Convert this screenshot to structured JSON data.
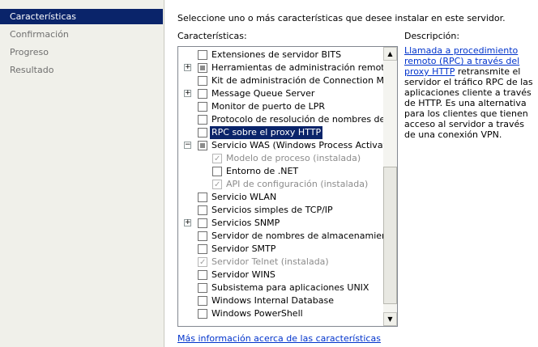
{
  "sidebar": {
    "items": [
      {
        "label": "Características",
        "active": true
      },
      {
        "label": "Confirmación",
        "active": false
      },
      {
        "label": "Progreso",
        "active": false
      },
      {
        "label": "Resultado",
        "active": false
      }
    ]
  },
  "main": {
    "instruction": "Seleccione uno o más características que desee instalar en este servidor.",
    "features_label": "Características:",
    "description_label": "Descripción:",
    "description_link": "Llamada a procedimiento remoto (RPC) a través del proxy HTTP",
    "description_text": "retransmite el servidor el tráfico RPC de las aplicaciones cliente a través de HTTP. Es una alternativa para los clientes que tienen acceso al servidor a través de una conexión VPN.",
    "more_info_link": "Más información acerca de las características"
  },
  "features": [
    {
      "label": "Extensiones de servidor BITS",
      "level": 0,
      "expander": "",
      "state": "unchecked"
    },
    {
      "label": "Herramientas de administración remota del s",
      "level": 0,
      "expander": "+",
      "state": "partial"
    },
    {
      "label": "Kit de administración de Connection Manage",
      "level": 0,
      "expander": "",
      "state": "unchecked"
    },
    {
      "label": "Message Queue Server",
      "level": 0,
      "expander": "+",
      "state": "unchecked"
    },
    {
      "label": "Monitor de puerto de LPR",
      "level": 0,
      "expander": "",
      "state": "unchecked"
    },
    {
      "label": "Protocolo de resolución de nombres de mism",
      "level": 0,
      "expander": "",
      "state": "unchecked"
    },
    {
      "label": "RPC sobre el proxy HTTP",
      "level": 0,
      "expander": "",
      "state": "unchecked",
      "selected": true
    },
    {
      "label": "Servicio WAS (Windows Process Activation S",
      "level": 0,
      "expander": "−",
      "state": "partial"
    },
    {
      "label": "Modelo de proceso (instalada)",
      "level": 1,
      "expander": "",
      "state": "checked-disabled"
    },
    {
      "label": "Entorno de .NET",
      "level": 1,
      "expander": "",
      "state": "unchecked"
    },
    {
      "label": "API de configuración (instalada)",
      "level": 1,
      "expander": "",
      "state": "checked-disabled"
    },
    {
      "label": "Servicio WLAN",
      "level": 0,
      "expander": "",
      "state": "unchecked"
    },
    {
      "label": "Servicios simples de TCP/IP",
      "level": 0,
      "expander": "",
      "state": "unchecked"
    },
    {
      "label": "Servicios SNMP",
      "level": 0,
      "expander": "+",
      "state": "unchecked"
    },
    {
      "label": "Servidor de nombres de almacenamiento de",
      "level": 0,
      "expander": "",
      "state": "unchecked"
    },
    {
      "label": "Servidor SMTP",
      "level": 0,
      "expander": "",
      "state": "unchecked"
    },
    {
      "label": "Servidor Telnet (instalada)",
      "level": 0,
      "expander": "",
      "state": "checked-disabled"
    },
    {
      "label": "Servidor WINS",
      "level": 0,
      "expander": "",
      "state": "unchecked"
    },
    {
      "label": "Subsistema para aplicaciones UNIX",
      "level": 0,
      "expander": "",
      "state": "unchecked"
    },
    {
      "label": "Windows Internal Database",
      "level": 0,
      "expander": "",
      "state": "unchecked"
    },
    {
      "label": "Windows PowerShell",
      "level": 0,
      "expander": "",
      "state": "unchecked"
    }
  ]
}
